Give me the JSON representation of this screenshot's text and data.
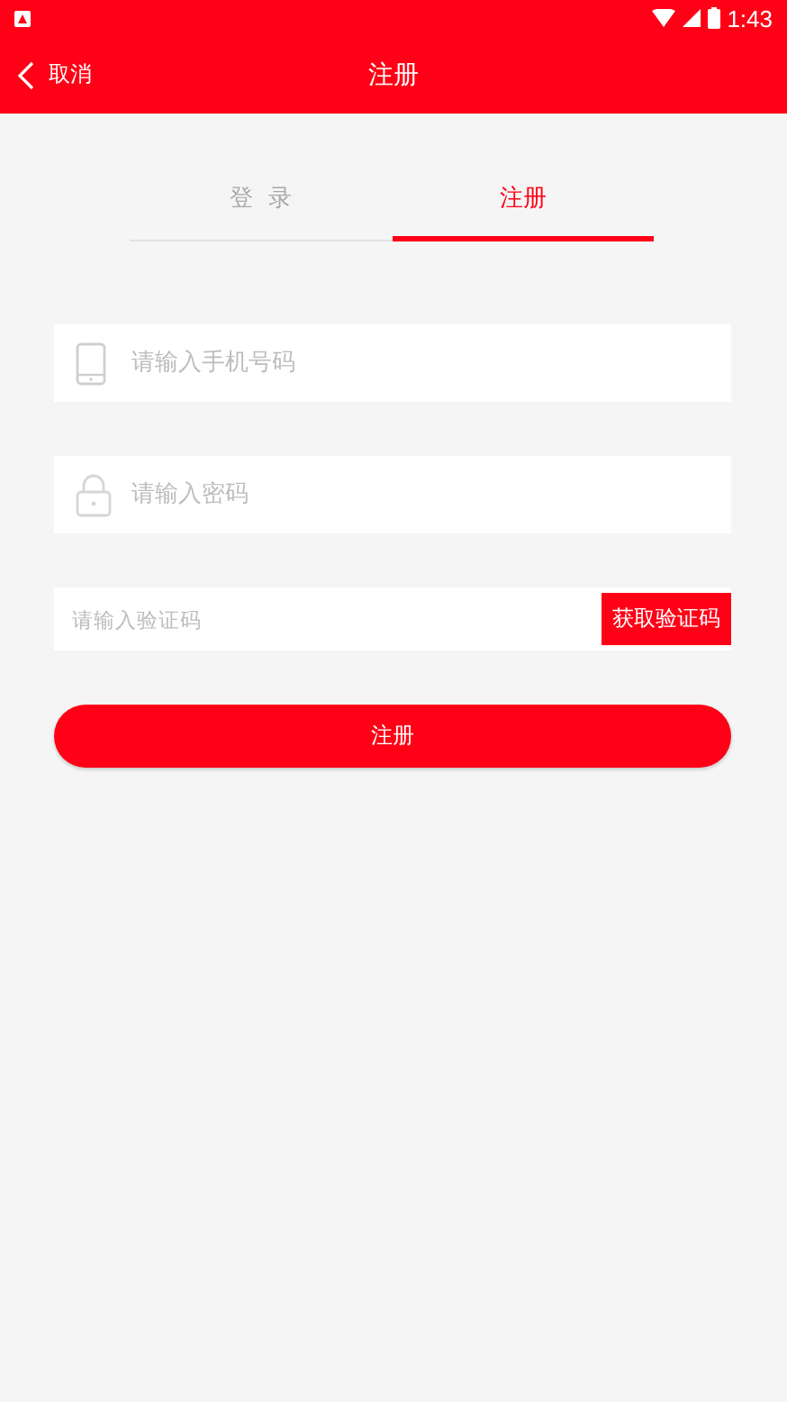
{
  "status_bar": {
    "time": "1:43"
  },
  "header": {
    "back": "取消",
    "title": "注册"
  },
  "tabs": [
    {
      "label": "登  录",
      "selected": false
    },
    {
      "label": "注册",
      "selected": true
    }
  ],
  "fields": [
    {
      "kind": "phone",
      "placeholder": "请输入手机号码"
    },
    {
      "kind": "password",
      "placeholder": "请输入密码"
    },
    {
      "kind": "code",
      "placeholder": "请输入验证码",
      "action": "获取验证码"
    }
  ],
  "submit": "注册"
}
